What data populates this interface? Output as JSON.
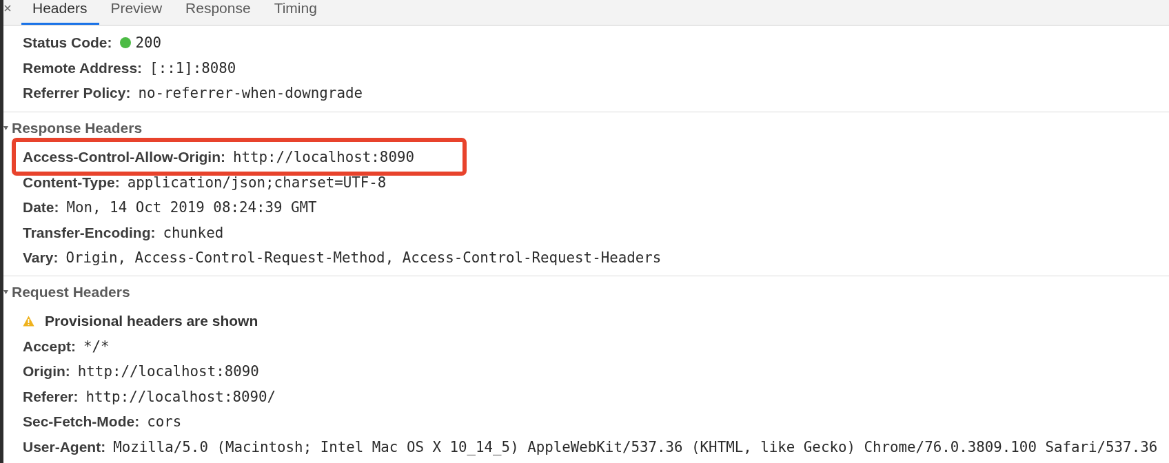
{
  "tabs": [
    {
      "label": "Headers",
      "selected": true
    },
    {
      "label": "Preview",
      "selected": false
    },
    {
      "label": "Response",
      "selected": false
    },
    {
      "label": "Timing",
      "selected": false
    }
  ],
  "sections": [
    {
      "items": [
        {
          "name": "Status Code:",
          "value": "200",
          "color": "#4cbb45",
          "highlighted": false
        },
        {
          "name": "Remote Address:",
          "value": "[::1]:8080",
          "highlighted": false
        },
        {
          "name": "Referrer Policy:",
          "value": "no-referrer-when-downgrade",
          "highlighted": false
        }
      ]
    },
    {
      "title": "Response Headers",
      "expanded": true,
      "items": [
        {
          "name": "Access-Control-Allow-Origin:",
          "value": "http://localhost:8090",
          "highlighted": true
        },
        {
          "name": "Content-Type:",
          "value": "application/json;charset=UTF-8",
          "highlighted": false
        },
        {
          "name": "Date:",
          "value": "Mon, 14 Oct 2019 08:24:39 GMT",
          "highlighted": false
        },
        {
          "name": "Transfer-Encoding:",
          "value": "chunked",
          "highlighted": false
        },
        {
          "name": "Vary:",
          "value": "Origin, Access-Control-Request-Method, Access-Control-Request-Headers",
          "highlighted": false
        }
      ]
    },
    {
      "title": "Request Headers",
      "expanded": true,
      "notice": {
        "kind": "warning",
        "text": "Provisional headers are shown"
      },
      "items": [
        {
          "name": "Accept:",
          "value": "*/*",
          "highlighted": false
        },
        {
          "name": "Origin:",
          "value": "http://localhost:8090",
          "highlighted": false
        },
        {
          "name": "Referer:",
          "value": "http://localhost:8090/",
          "highlighted": false
        },
        {
          "name": "Sec-Fetch-Mode:",
          "value": "cors",
          "highlighted": false
        },
        {
          "name": "User-Agent:",
          "value": "Mozilla/5.0 (Macintosh; Intel Mac OS X 10_14_5) AppleWebKit/537.36 (KHTML, like Gecko) Chrome/76.0.3809.100 Safari/537.36",
          "highlighted": false
        }
      ]
    }
  ]
}
